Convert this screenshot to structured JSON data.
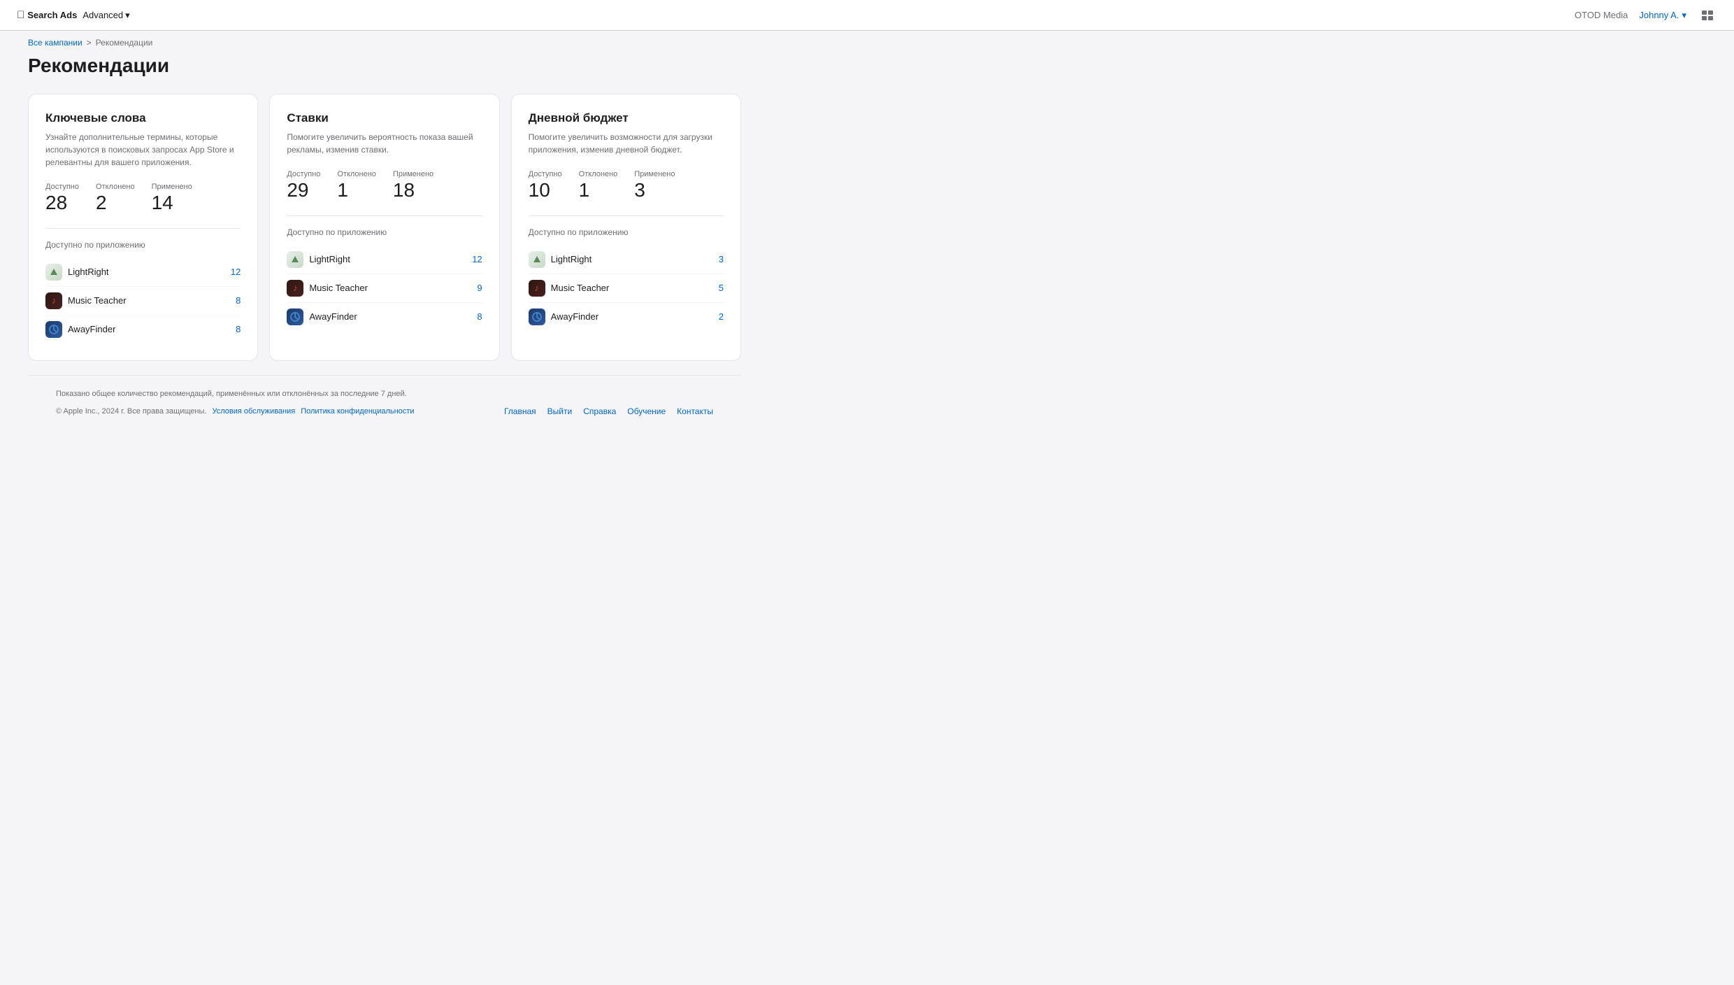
{
  "nav": {
    "logo": "Search Ads",
    "apple_symbol": "🍎",
    "advanced_label": "Advanced",
    "org_name": "OTOD Media",
    "user_name": "Johnny A.",
    "chevron": "▾"
  },
  "breadcrumb": {
    "all_campaigns": "Все кампании",
    "separator": ">",
    "current": "Рекомендации"
  },
  "page": {
    "title": "Рекомендации"
  },
  "cards": [
    {
      "id": "keywords",
      "title": "Ключевые слова",
      "description": "Узнайте дополнительные термины, которые используются в поисковых запросах App Store и релевантны для вашего приложения.",
      "stats": {
        "available_label": "Доступно",
        "available_value": "28",
        "declined_label": "Отклонено",
        "declined_value": "2",
        "applied_label": "Применено",
        "applied_value": "14"
      },
      "apps_section_title": "Доступно по приложению",
      "apps": [
        {
          "name": "LightRight",
          "icon_type": "lightright",
          "count": "12"
        },
        {
          "name": "Music Teacher",
          "icon_type": "musicteacher",
          "count": "8"
        },
        {
          "name": "AwayFinder",
          "icon_type": "awayfinder",
          "count": "8"
        }
      ]
    },
    {
      "id": "bids",
      "title": "Ставки",
      "description": "Помогите увеличить вероятность показа вашей рекламы, изменив ставки.",
      "stats": {
        "available_label": "Доступно",
        "available_value": "29",
        "declined_label": "Отклонено",
        "declined_value": "1",
        "applied_label": "Применено",
        "applied_value": "18"
      },
      "apps_section_title": "Доступно по приложению",
      "apps": [
        {
          "name": "LightRight",
          "icon_type": "lightright",
          "count": "12"
        },
        {
          "name": "Music Teacher",
          "icon_type": "musicteacher",
          "count": "9"
        },
        {
          "name": "AwayFinder",
          "icon_type": "awayfinder",
          "count": "8"
        }
      ]
    },
    {
      "id": "daily-budget",
      "title": "Дневной бюджет",
      "description": "Помогите увеличить возможности для загрузки приложения, изменив дневной бюджет.",
      "stats": {
        "available_label": "Доступно",
        "available_value": "10",
        "declined_label": "Отклонено",
        "declined_value": "1",
        "applied_label": "Применено",
        "applied_value": "3"
      },
      "apps_section_title": "Доступно по приложению",
      "apps": [
        {
          "name": "LightRight",
          "icon_type": "lightright",
          "count": "3"
        },
        {
          "name": "Music Teacher",
          "icon_type": "musicteacher",
          "count": "5"
        },
        {
          "name": "AwayFinder",
          "icon_type": "awayfinder",
          "count": "2"
        }
      ]
    }
  ],
  "footer": {
    "note": "Показано общее количество рекомендаций, применённых или отклонённых за последние 7 дней.",
    "copyright": "© Apple Inc., 2024 г. Все права защищены.",
    "links_left": [
      {
        "label": "Условия обслуживания",
        "href": "#"
      },
      {
        "label": "Политика конфиденциальности",
        "href": "#"
      }
    ],
    "links_right": [
      {
        "label": "Главная",
        "href": "#"
      },
      {
        "label": "Выйти",
        "href": "#"
      },
      {
        "label": "Справка",
        "href": "#"
      },
      {
        "label": "Обучение",
        "href": "#"
      },
      {
        "label": "Контакты",
        "href": "#"
      }
    ]
  }
}
